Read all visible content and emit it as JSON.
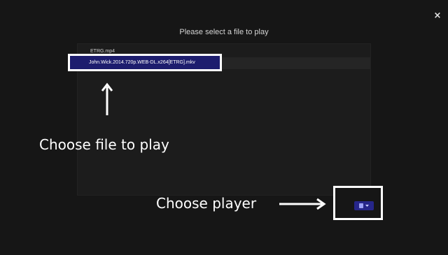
{
  "dialog": {
    "title": "Please select a file to play",
    "close_label": "×"
  },
  "files": [
    {
      "name": "ETRG.mp4",
      "selected": false
    },
    {
      "name": "John.Wick.2014.720p.WEB-DL.x264[ETRG].mkv",
      "selected": true
    }
  ],
  "annotations": {
    "choose_file": "Choose file to play",
    "choose_player": "Choose player"
  },
  "player_select": {
    "icon": "device-icon",
    "dropdown_icon": "caret-down-icon"
  },
  "colors": {
    "background": "#161616",
    "panel": "#1c1c1c",
    "selection": "#1d1d6e",
    "player_button": "#26268a",
    "annotation": "#ffffff"
  }
}
